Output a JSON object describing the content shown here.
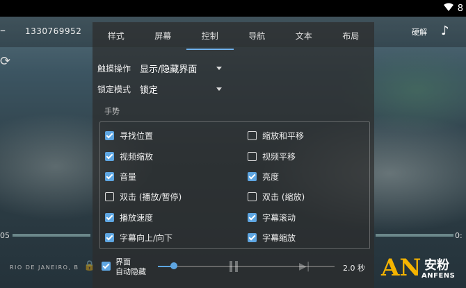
{
  "status": {
    "signal": "wifi-icon",
    "partial_text": "8"
  },
  "topbar": {
    "title": "1330769952",
    "hw_label": "硬解"
  },
  "player": {
    "seek_left": "05",
    "seek_right": "0:",
    "location": "RIO DE JANEIRO, B"
  },
  "dialog": {
    "tabs": [
      {
        "label": "样式"
      },
      {
        "label": "屏幕"
      },
      {
        "label": "控制"
      },
      {
        "label": "导航"
      },
      {
        "label": "文本"
      },
      {
        "label": "布局"
      }
    ],
    "active_tab": "控制",
    "touch": {
      "label": "触摸操作",
      "value": "显示/隐藏界面"
    },
    "lock": {
      "label": "锁定模式",
      "value": "锁定"
    },
    "gesture_title": "手势",
    "gestures_left": [
      {
        "label": "寻找位置",
        "checked": true
      },
      {
        "label": "视频缩放",
        "checked": true
      },
      {
        "label": "音量",
        "checked": true
      },
      {
        "label": "双击 (播放/暂停)",
        "checked": false
      },
      {
        "label": "播放速度",
        "checked": true
      },
      {
        "label": "字幕向上/向下",
        "checked": true
      }
    ],
    "gestures_right": [
      {
        "label": "缩放和平移",
        "checked": false
      },
      {
        "label": "视频平移",
        "checked": false
      },
      {
        "label": "亮度",
        "checked": true
      },
      {
        "label": "双击 (缩放)",
        "checked": false
      },
      {
        "label": "字幕滚动",
        "checked": true
      },
      {
        "label": "字幕缩放",
        "checked": true
      }
    ],
    "auto_hide": {
      "line1": "界面",
      "line2": "自动隐藏",
      "checked": true,
      "value": "2.0 秒",
      "level": 0.09
    }
  },
  "watermark": {
    "an": "AN",
    "cn": "安粉",
    "en": "ANFENS"
  },
  "colors": {
    "accent": "#5ea6e2",
    "watermark": "#f5b400"
  }
}
